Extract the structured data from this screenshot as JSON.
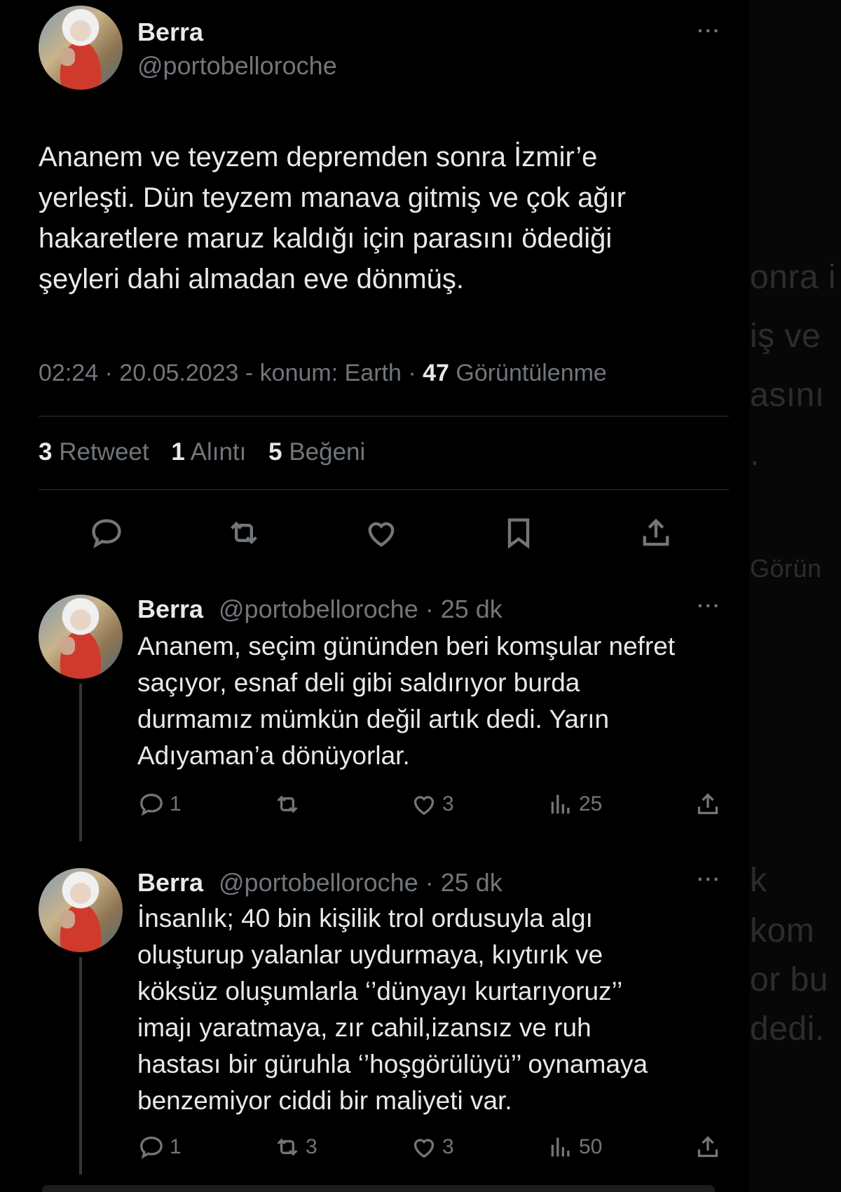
{
  "main_tweet": {
    "name": "Berra",
    "handle": "@portobelloroche",
    "text_lines": [
      "Ananem ve teyzem depremden sonra İzmir’e",
      "yerleşti. Dün teyzem manava gitmiş ve çok ağır",
      "hakaretlere maruz kaldığı için parasını ödediği",
      "şeyleri dahi almadan eve dönmüş."
    ],
    "meta_prefix": "02:24 · 20.05.2023 - konum: Earth · ",
    "views_count": "47",
    "views_label": " Görüntülenme",
    "stats": {
      "retweet_count": "3",
      "retweet_label": "Retweet",
      "quote_count": "1",
      "quote_label": "Alıntı",
      "like_count": "5",
      "like_label": "Beğeni"
    }
  },
  "replies": [
    {
      "name": "Berra",
      "handle_time": "@portobelloroche · 25 dk",
      "text_lines": [
        "Ananem, seçim gününden beri komşular nefret",
        "saçıyor, esnaf deli gibi saldırıyor burda",
        "durmamız mümkün değil artık dedi. Yarın",
        "Adıyaman’a dönüyorlar."
      ],
      "reply_count": "1",
      "retweet_count": "",
      "like_count": "3",
      "views_count": "25"
    },
    {
      "name": "Berra",
      "handle_time": "@portobelloroche · 25 dk",
      "text_lines": [
        "İnsanlık; 40 bin kişilik trol ordusuyla algı",
        "oluşturup yalanlar uydurmaya, kıytırık ve",
        "köksüz oluşumlarla ‘’dünyayı kurtarıyoruz’’",
        "imajı yaratmaya, zır cahil,izansız ve  ruh",
        "hastası bir güruhla ‘’hoşgörülüyü’’ oynamaya",
        "benzemiyor ciddi bir maliyeti var."
      ],
      "reply_count": "1",
      "retweet_count": "3",
      "like_count": "3",
      "views_count": "50"
    }
  ],
  "more_label": "···",
  "background_ghost_text": [
    "onra i",
    "iş ve",
    "asını",
    ".",
    "Görün",
    "k",
    "kom",
    "or bu",
    "dedi."
  ],
  "icons": [
    "reply-icon",
    "retweet-icon",
    "like-icon",
    "bookmark-icon",
    "share-icon",
    "views-icon",
    "more-icon"
  ],
  "colors": {
    "background": "#000000",
    "text": "#e7e9ea",
    "secondary": "#71767b",
    "divider": "#2f3336"
  }
}
